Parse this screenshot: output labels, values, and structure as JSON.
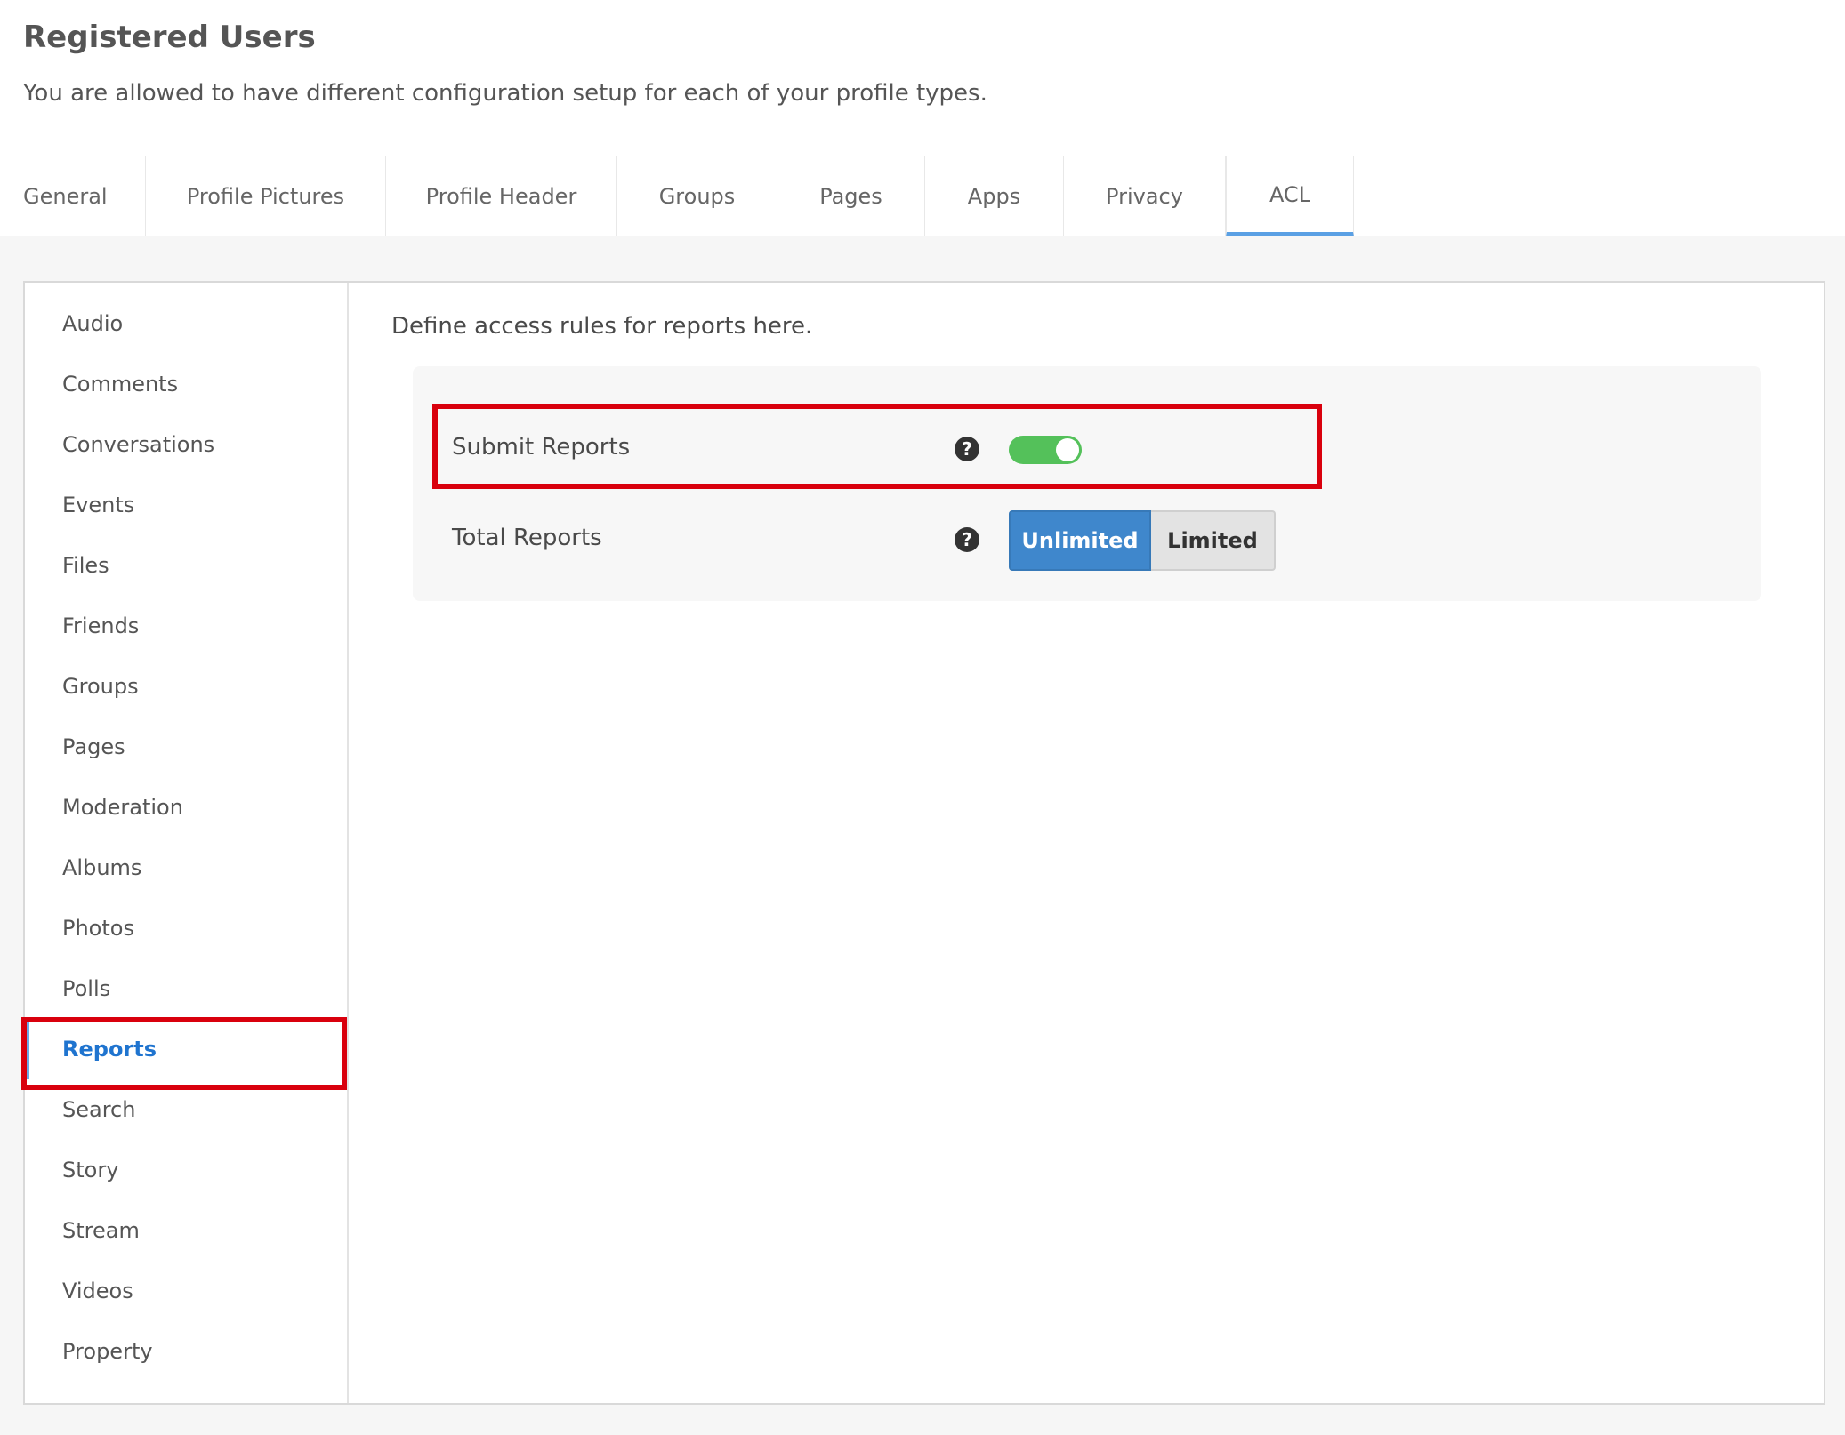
{
  "header": {
    "title": "Registered Users",
    "subtitle": "You are allowed to have different configuration setup for each of your profile types."
  },
  "tabs": [
    {
      "label": "General"
    },
    {
      "label": "Profile Pictures"
    },
    {
      "label": "Profile Header"
    },
    {
      "label": "Groups"
    },
    {
      "label": "Pages"
    },
    {
      "label": "Apps"
    },
    {
      "label": "Privacy"
    },
    {
      "label": "ACL"
    }
  ],
  "active_tab": "ACL",
  "sidebar": {
    "items": [
      {
        "label": "Audio"
      },
      {
        "label": "Comments"
      },
      {
        "label": "Conversations"
      },
      {
        "label": "Events"
      },
      {
        "label": "Files"
      },
      {
        "label": "Friends"
      },
      {
        "label": "Groups"
      },
      {
        "label": "Pages"
      },
      {
        "label": "Moderation"
      },
      {
        "label": "Albums"
      },
      {
        "label": "Photos"
      },
      {
        "label": "Polls"
      },
      {
        "label": "Reports"
      },
      {
        "label": "Search"
      },
      {
        "label": "Story"
      },
      {
        "label": "Stream"
      },
      {
        "label": "Videos"
      },
      {
        "label": "Property"
      }
    ],
    "active_item": "Reports"
  },
  "content": {
    "description": "Define access rules for reports here.",
    "rules": {
      "submit_reports": {
        "label": "Submit Reports",
        "enabled": true,
        "help_icon": "question-circle-icon"
      },
      "total_reports": {
        "label": "Total Reports",
        "help_icon": "question-circle-icon",
        "options": [
          "Unlimited",
          "Limited"
        ],
        "selected": "Unlimited"
      }
    }
  },
  "colors": {
    "accent_blue": "#3f87cc",
    "active_link": "#1f74cf",
    "toggle_on": "#54c15a",
    "highlight_red": "#d9000d"
  }
}
